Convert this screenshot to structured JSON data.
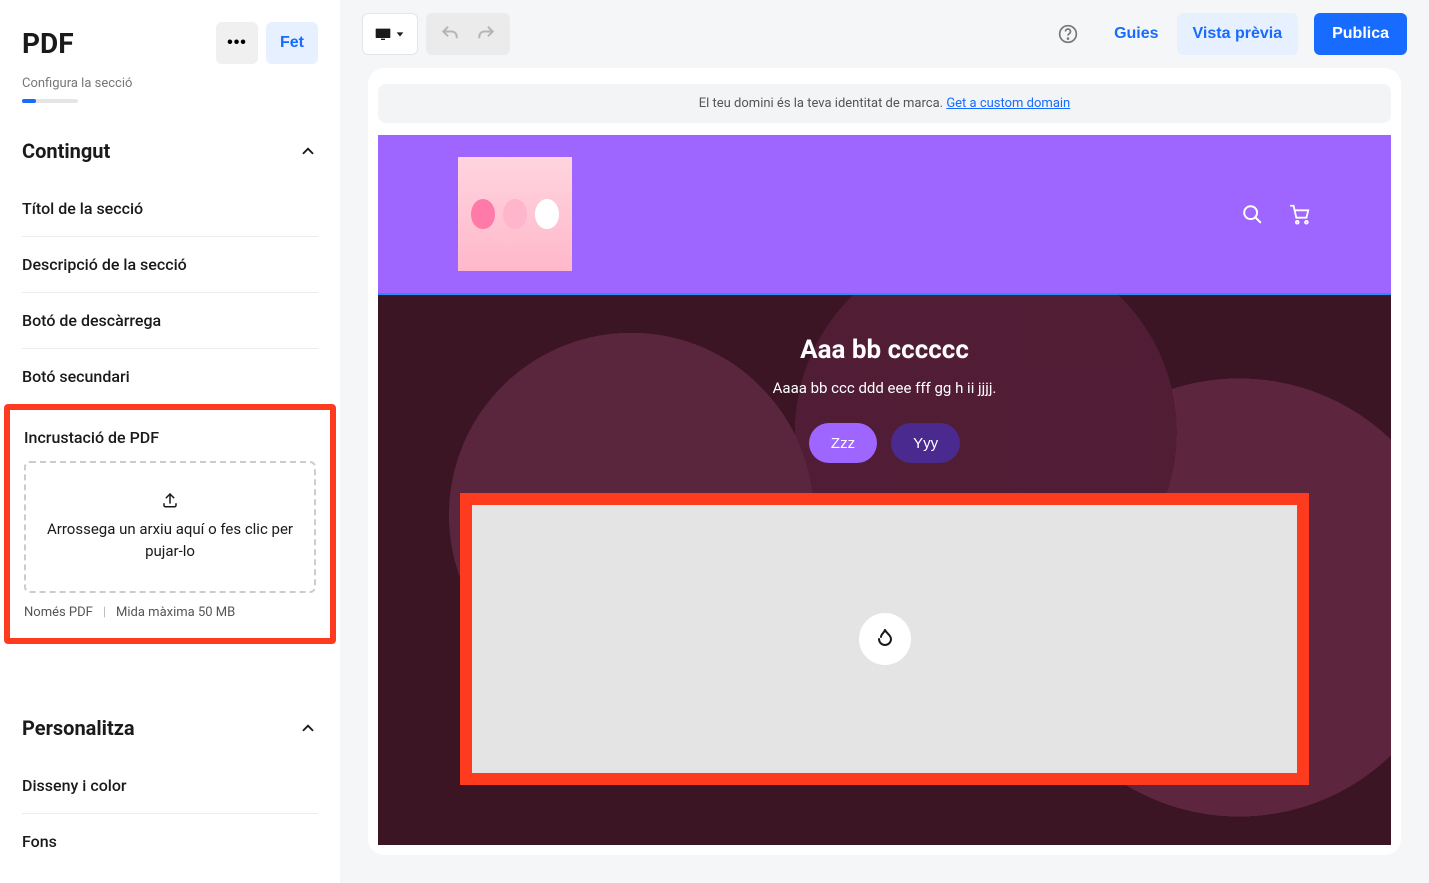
{
  "sidebar": {
    "title": "PDF",
    "done_label": "Fet",
    "subtitle": "Configura la secció",
    "content": {
      "header": "Contingut",
      "items": [
        "Títol de la secció",
        "Descripció de la secció",
        "Botó de descàrrega",
        "Botó secundari"
      ],
      "pdf_embed": {
        "title": "Incrustació de PDF",
        "dropzone_text": "Arrossega un arxiu aquí o fes clic per pujar-lo",
        "hint_only": "Només PDF",
        "hint_size": "Mida màxima 50 MB"
      }
    },
    "personalize": {
      "header": "Personalitza",
      "items": [
        "Disseny i color",
        "Fons"
      ]
    }
  },
  "topbar": {
    "guides": "Guies",
    "preview": "Vista prèvia",
    "publish": "Publica"
  },
  "banner": {
    "text": "El teu domini és la teva identitat de marca.",
    "link": "Get a custom domain"
  },
  "hero": {
    "title": "Aaa bb cccccc",
    "subtitle": "Aaaa bb ccc ddd eee fff gg h ii jjjj.",
    "btn_primary": "Zzz",
    "btn_secondary": "Yyy"
  }
}
